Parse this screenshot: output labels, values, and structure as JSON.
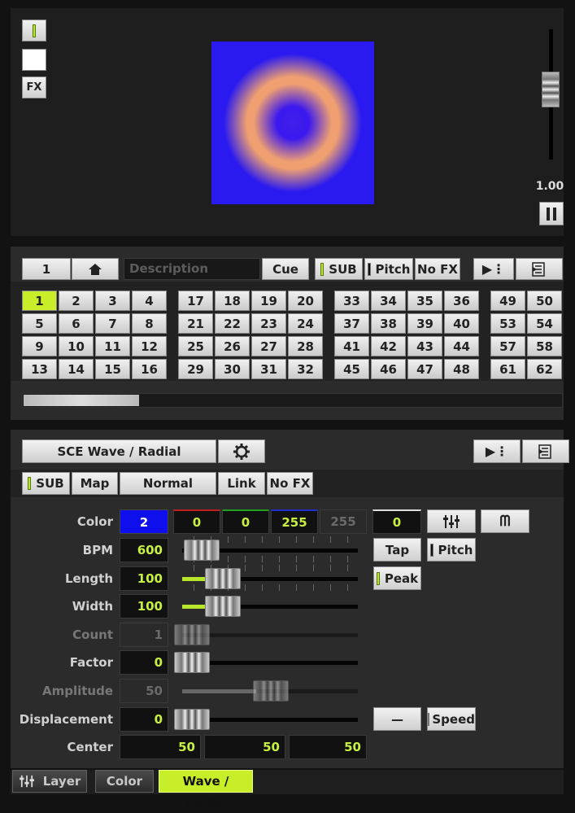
{
  "preview": {
    "fx_label": "FX",
    "master_value": "1.00",
    "colors": {
      "outer": "#2a1af0",
      "ring": "#f0a070",
      "center": "#3010f0"
    }
  },
  "cue_bar": {
    "number": "1",
    "description_placeholder": "Description",
    "cue_label": "Cue",
    "sub_label": "SUB",
    "pitch_label": "Pitch",
    "nofx_label": "No FX"
  },
  "cue_grid": {
    "group1": [
      [
        "1",
        "2",
        "3",
        "4"
      ],
      [
        "5",
        "6",
        "7",
        "8"
      ],
      [
        "9",
        "10",
        "11",
        "12"
      ],
      [
        "13",
        "14",
        "15",
        "16"
      ]
    ],
    "group2": [
      [
        "17",
        "18",
        "19",
        "20"
      ],
      [
        "21",
        "22",
        "23",
        "24"
      ],
      [
        "25",
        "26",
        "27",
        "28"
      ],
      [
        "29",
        "30",
        "31",
        "32"
      ]
    ],
    "group3": [
      [
        "33",
        "34",
        "35",
        "36"
      ],
      [
        "37",
        "38",
        "39",
        "40"
      ],
      [
        "41",
        "42",
        "43",
        "44"
      ],
      [
        "45",
        "46",
        "47",
        "48"
      ]
    ],
    "group4": [
      [
        "49",
        "50"
      ],
      [
        "53",
        "54"
      ],
      [
        "57",
        "58"
      ],
      [
        "61",
        "62"
      ]
    ],
    "selected": "1"
  },
  "effect": {
    "name": "SCE Wave / Radial",
    "toolbar": {
      "sub": "SUB",
      "map": "Map",
      "blend": "Normal",
      "link": "Link",
      "nofx": "No FX"
    },
    "color": {
      "label": "Color",
      "index": "2",
      "r": "0",
      "g": "0",
      "b": "255",
      "a": "255",
      "w": "0",
      "swatch": "#1010ee"
    },
    "bpm": {
      "label": "BPM",
      "value": "600"
    },
    "length": {
      "label": "Length",
      "value": "100"
    },
    "width": {
      "label": "Width",
      "value": "100"
    },
    "count": {
      "label": "Count",
      "value": "1"
    },
    "factor": {
      "label": "Factor",
      "value": "0"
    },
    "amplitude": {
      "label": "Amplitude",
      "value": "50"
    },
    "displacement": {
      "label": "Displacement",
      "value": "0"
    },
    "center": {
      "label": "Center",
      "x": "50",
      "y": "50",
      "z": "50"
    },
    "tap_label": "Tap",
    "pitch_label": "Pitch",
    "peak_label": "Peak",
    "speed_label": "Speed",
    "dash_label": "—"
  },
  "bottom_tabs": {
    "layer": "Layer",
    "color": "Color",
    "wave": "Wave / Radial"
  }
}
